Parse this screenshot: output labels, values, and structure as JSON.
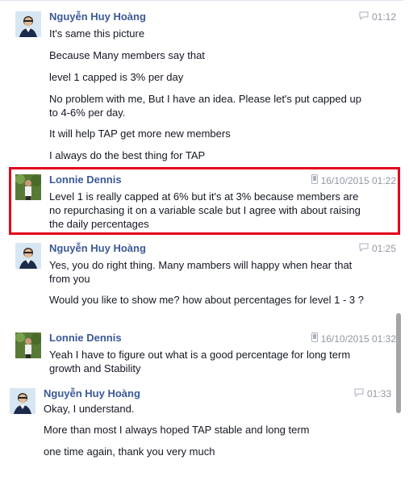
{
  "messages": [
    {
      "sender": "Nguyễn Huy Hoàng",
      "time": "01:12",
      "device_icon": "chat-bubble-icon",
      "lines": [
        "It's same this picture",
        "Because Many members say that",
        "level 1 capped is 3% per day",
        "No problem with me, But I have an idea. Please let's put capped up to 4-6% per day.",
        "It will help TAP get more new members",
        "I always do the best thing for TAP"
      ]
    },
    {
      "sender": "Lonnie Dennis",
      "time": "16/10/2015 01:22",
      "device_icon": "mobile-phone-icon",
      "lines": [
        "Level 1 is really capped at 6% but it's at 3% because members are no repurchasing it on a variable scale but I agree with about raising the daily percentages"
      ]
    },
    {
      "sender": "Nguyễn Huy Hoàng",
      "time": "01:25",
      "device_icon": "chat-bubble-icon",
      "lines": [
        "Yes, you do right thing. Many mambers will happy when hear that from you",
        "Would you like to show me? how about percentages for level 1 - 3 ?"
      ]
    },
    {
      "sender": "Lonnie Dennis",
      "time": "16/10/2015 01:32",
      "device_icon": "mobile-phone-icon",
      "lines": [
        "Yeah I have to figure out what is a good percentage for long term growth and Stability"
      ]
    },
    {
      "sender": "Nguyễn Huy Hoàng",
      "time": "01:33",
      "device_icon": "chat-bubble-icon",
      "lines": [
        "Okay, I understand.",
        "More than most I always hoped TAP stable and long term",
        "one time again, thank you very much"
      ]
    }
  ],
  "colors": {
    "sender_name": "#3b5998",
    "timestamp": "#9197a3",
    "highlight_border": "#e3001b"
  }
}
